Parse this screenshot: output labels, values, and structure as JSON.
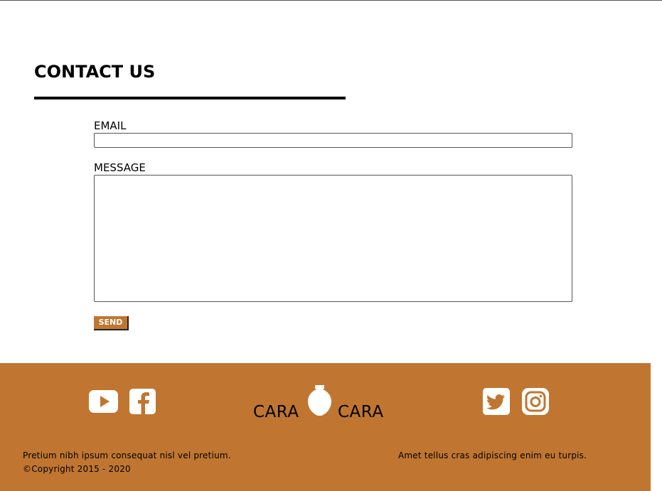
{
  "contact": {
    "heading": "CONTACT US",
    "email_label": "EMAIL",
    "email_value": "",
    "message_label": "MESSAGE",
    "message_value": "",
    "send_label": "SEND"
  },
  "footer": {
    "brand_left": "CARA",
    "brand_right": "CARA",
    "left_line_1": "Pretium nibh ipsum consequat nisl vel pretium.",
    "left_line_2": "©Copyright 2015 - 2020",
    "right_line": "Amet tellus cras adipiscing enim eu turpis.",
    "social_left": [
      "youtube-icon",
      "facebook-icon"
    ],
    "social_right": [
      "twitter-icon",
      "instagram-icon"
    ]
  },
  "colors": {
    "accent": "#c07630",
    "icon": "#ffffff",
    "text": "#000000"
  }
}
